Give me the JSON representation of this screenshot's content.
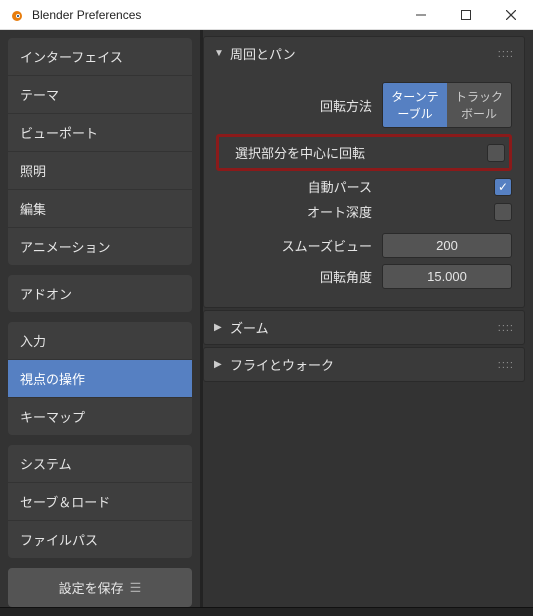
{
  "window": {
    "title": "Blender Preferences"
  },
  "sidebar": {
    "groups": [
      [
        "インターフェイス",
        "テーマ",
        "ビューポート",
        "照明",
        "編集",
        "アニメーション"
      ],
      [
        "アドオン"
      ],
      [
        "入力",
        "視点の操作",
        "キーマップ"
      ],
      [
        "システム",
        "セーブ＆ロード",
        "ファイルパス"
      ]
    ],
    "active": "視点の操作",
    "save_label": "設定を保存"
  },
  "panels": {
    "orbit": {
      "title": "周回とパン",
      "expanded": true,
      "rotation_method": {
        "label": "回転方法",
        "options": [
          "ターンテーブル",
          "トラックボール"
        ],
        "selected": 0
      },
      "rotate_around_sel": {
        "label": "選択部分を中心に回転",
        "checked": false
      },
      "auto_perspective": {
        "label": "自動パース",
        "checked": true
      },
      "auto_depth": {
        "label": "オート深度",
        "checked": false
      },
      "smooth_view": {
        "label": "スムーズビュー",
        "value": "200"
      },
      "rotation_angle": {
        "label": "回転角度",
        "value": "15.000"
      }
    },
    "zoom": {
      "title": "ズーム",
      "expanded": false
    },
    "fly": {
      "title": "フライとウォーク",
      "expanded": false
    }
  }
}
